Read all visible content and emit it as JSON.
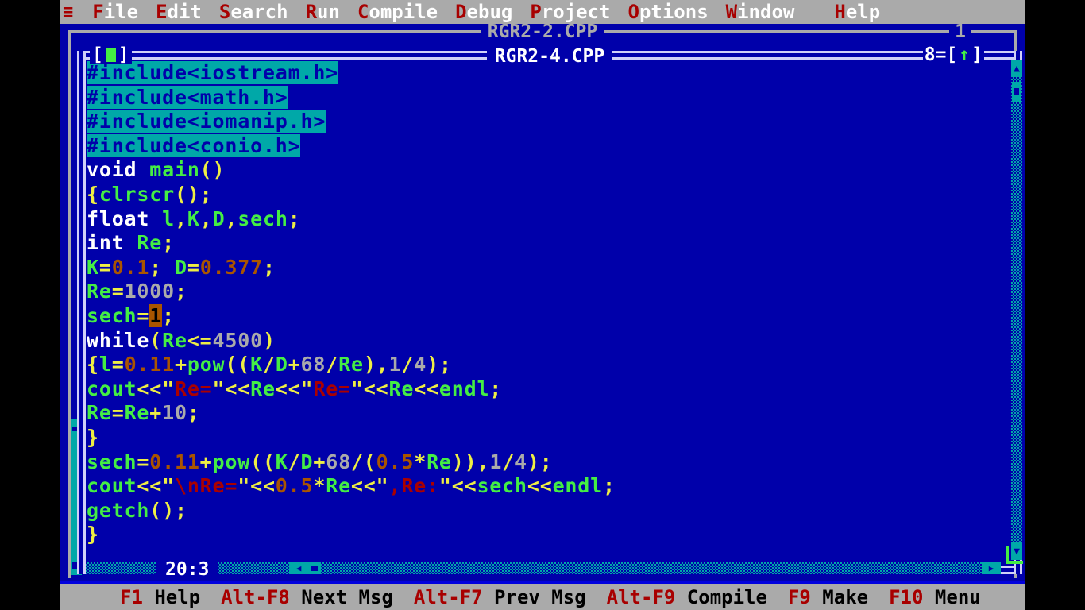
{
  "app": {
    "title": "Turbo C++ IDE",
    "hamburger_icon": "hamburger-icon"
  },
  "menubar": {
    "items": [
      {
        "hot": "F",
        "rest": "ile"
      },
      {
        "hot": "E",
        "rest": "dit"
      },
      {
        "hot": "S",
        "rest": "earch"
      },
      {
        "hot": "R",
        "rest": "un"
      },
      {
        "hot": "C",
        "rest": "ompile"
      },
      {
        "hot": "D",
        "rest": "ebug"
      },
      {
        "hot": "P",
        "rest": "roject"
      },
      {
        "hot": "O",
        "rest": "ptions"
      },
      {
        "hot": "W",
        "rest": "indow"
      },
      {
        "hot": "H",
        "rest": "elp"
      }
    ]
  },
  "background_window": {
    "title": "RGR2-2.CPP",
    "number": "1"
  },
  "active_window": {
    "title": "RGR2-4.CPP",
    "number": "8",
    "close_left": "[",
    "close_right": "]",
    "zoom_left": "[",
    "zoom_right": "]",
    "zoom_arrow": "↑",
    "equals": "=",
    "cursor_position": "20:3"
  },
  "scrollbars": {
    "v_up_arrow": "▲",
    "v_down_arrow": "▼",
    "h_left_arrow": "◀",
    "h_right_arrow": "▶"
  },
  "editor": {
    "lines": [
      [
        {
          "t": "#include<iostream.h>",
          "c": "tk-pre"
        }
      ],
      [
        {
          "t": "#include<math.h>",
          "c": "tk-pre"
        }
      ],
      [
        {
          "t": "#include<iomanip.h>",
          "c": "tk-pre"
        }
      ],
      [
        {
          "t": "#include<conio.h>",
          "c": "tk-pre"
        }
      ],
      [
        {
          "t": "void",
          "c": "tk-kw"
        },
        {
          "t": " ",
          "c": "tk-id"
        },
        {
          "t": "main",
          "c": "tk-id"
        },
        {
          "t": "()",
          "c": "tk-punc"
        }
      ],
      [
        {
          "t": "{",
          "c": "tk-punc"
        },
        {
          "t": "clrscr",
          "c": "tk-id"
        },
        {
          "t": "();",
          "c": "tk-punc"
        }
      ],
      [
        {
          "t": "float",
          "c": "tk-kw"
        },
        {
          "t": " ",
          "c": "tk-id"
        },
        {
          "t": "l",
          "c": "tk-id"
        },
        {
          "t": ",",
          "c": "tk-punc"
        },
        {
          "t": "K",
          "c": "tk-id"
        },
        {
          "t": ",",
          "c": "tk-punc"
        },
        {
          "t": "D",
          "c": "tk-id"
        },
        {
          "t": ",",
          "c": "tk-punc"
        },
        {
          "t": "sech",
          "c": "tk-id"
        },
        {
          "t": ";",
          "c": "tk-punc"
        }
      ],
      [
        {
          "t": "int",
          "c": "tk-kw"
        },
        {
          "t": " ",
          "c": "tk-id"
        },
        {
          "t": "Re",
          "c": "tk-id"
        },
        {
          "t": ";",
          "c": "tk-punc"
        }
      ],
      [
        {
          "t": "K",
          "c": "tk-id"
        },
        {
          "t": "=",
          "c": "tk-punc"
        },
        {
          "t": "0.1",
          "c": "tk-num"
        },
        {
          "t": ";",
          "c": "tk-punc"
        },
        {
          "t": " ",
          "c": "tk-id"
        },
        {
          "t": "D",
          "c": "tk-id"
        },
        {
          "t": "=",
          "c": "tk-punc"
        },
        {
          "t": "0.377",
          "c": "tk-num"
        },
        {
          "t": ";",
          "c": "tk-punc"
        }
      ],
      [
        {
          "t": "Re",
          "c": "tk-id"
        },
        {
          "t": "=",
          "c": "tk-punc"
        },
        {
          "t": "1000",
          "c": "tk-int"
        },
        {
          "t": ";",
          "c": "tk-punc"
        }
      ],
      [
        {
          "t": "sech",
          "c": "tk-id"
        },
        {
          "t": "=",
          "c": "tk-punc"
        },
        {
          "t": "1",
          "c": "tk-cursor"
        },
        {
          "t": ";",
          "c": "tk-punc"
        }
      ],
      [
        {
          "t": "while",
          "c": "tk-kw"
        },
        {
          "t": "(",
          "c": "tk-punc"
        },
        {
          "t": "Re",
          "c": "tk-id"
        },
        {
          "t": "<=",
          "c": "tk-punc"
        },
        {
          "t": "4500",
          "c": "tk-int"
        },
        {
          "t": ")",
          "c": "tk-punc"
        }
      ],
      [
        {
          "t": "{",
          "c": "tk-punc"
        },
        {
          "t": "l",
          "c": "tk-id"
        },
        {
          "t": "=",
          "c": "tk-punc"
        },
        {
          "t": "0.11",
          "c": "tk-num"
        },
        {
          "t": "+",
          "c": "tk-punc"
        },
        {
          "t": "pow",
          "c": "tk-id"
        },
        {
          "t": "((",
          "c": "tk-punc"
        },
        {
          "t": "K",
          "c": "tk-id"
        },
        {
          "t": "/",
          "c": "tk-punc"
        },
        {
          "t": "D",
          "c": "tk-id"
        },
        {
          "t": "+",
          "c": "tk-punc"
        },
        {
          "t": "68",
          "c": "tk-int"
        },
        {
          "t": "/",
          "c": "tk-punc"
        },
        {
          "t": "Re",
          "c": "tk-id"
        },
        {
          "t": "),",
          "c": "tk-punc"
        },
        {
          "t": "1",
          "c": "tk-int"
        },
        {
          "t": "/",
          "c": "tk-punc"
        },
        {
          "t": "4",
          "c": "tk-int"
        },
        {
          "t": ");",
          "c": "tk-punc"
        }
      ],
      [
        {
          "t": "cout",
          "c": "tk-id"
        },
        {
          "t": "<<",
          "c": "tk-punc"
        },
        {
          "t": "\"",
          "c": "tk-quote"
        },
        {
          "t": "Re=",
          "c": "tk-str"
        },
        {
          "t": "\"",
          "c": "tk-quote"
        },
        {
          "t": "<<",
          "c": "tk-punc"
        },
        {
          "t": "Re",
          "c": "tk-id"
        },
        {
          "t": "<<",
          "c": "tk-punc"
        },
        {
          "t": "\"",
          "c": "tk-quote"
        },
        {
          "t": "Re=",
          "c": "tk-str"
        },
        {
          "t": "\"",
          "c": "tk-quote"
        },
        {
          "t": "<<",
          "c": "tk-punc"
        },
        {
          "t": "Re",
          "c": "tk-id"
        },
        {
          "t": "<<",
          "c": "tk-punc"
        },
        {
          "t": "endl",
          "c": "tk-id"
        },
        {
          "t": ";",
          "c": "tk-punc"
        }
      ],
      [
        {
          "t": "Re",
          "c": "tk-id"
        },
        {
          "t": "=",
          "c": "tk-punc"
        },
        {
          "t": "Re",
          "c": "tk-id"
        },
        {
          "t": "+",
          "c": "tk-punc"
        },
        {
          "t": "10",
          "c": "tk-int"
        },
        {
          "t": ";",
          "c": "tk-punc"
        }
      ],
      [
        {
          "t": "}",
          "c": "tk-punc"
        }
      ],
      [
        {
          "t": "sech",
          "c": "tk-id"
        },
        {
          "t": "=",
          "c": "tk-punc"
        },
        {
          "t": "0.11",
          "c": "tk-num"
        },
        {
          "t": "+",
          "c": "tk-punc"
        },
        {
          "t": "pow",
          "c": "tk-id"
        },
        {
          "t": "((",
          "c": "tk-punc"
        },
        {
          "t": "K",
          "c": "tk-id"
        },
        {
          "t": "/",
          "c": "tk-punc"
        },
        {
          "t": "D",
          "c": "tk-id"
        },
        {
          "t": "+",
          "c": "tk-punc"
        },
        {
          "t": "68",
          "c": "tk-int"
        },
        {
          "t": "/(",
          "c": "tk-punc"
        },
        {
          "t": "0.5",
          "c": "tk-num"
        },
        {
          "t": "*",
          "c": "tk-punc"
        },
        {
          "t": "Re",
          "c": "tk-id"
        },
        {
          "t": ")),",
          "c": "tk-punc"
        },
        {
          "t": "1",
          "c": "tk-int"
        },
        {
          "t": "/",
          "c": "tk-punc"
        },
        {
          "t": "4",
          "c": "tk-int"
        },
        {
          "t": ");",
          "c": "tk-punc"
        }
      ],
      [
        {
          "t": "cout",
          "c": "tk-id"
        },
        {
          "t": "<<",
          "c": "tk-punc"
        },
        {
          "t": "\"",
          "c": "tk-quote"
        },
        {
          "t": "\\nRe=",
          "c": "tk-str"
        },
        {
          "t": "\"",
          "c": "tk-quote"
        },
        {
          "t": "<<",
          "c": "tk-punc"
        },
        {
          "t": "0.5",
          "c": "tk-num"
        },
        {
          "t": "*",
          "c": "tk-punc"
        },
        {
          "t": "Re",
          "c": "tk-id"
        },
        {
          "t": "<<",
          "c": "tk-punc"
        },
        {
          "t": "\"",
          "c": "tk-quote"
        },
        {
          "t": ",Re:",
          "c": "tk-str"
        },
        {
          "t": "\"",
          "c": "tk-quote"
        },
        {
          "t": "<<",
          "c": "tk-punc"
        },
        {
          "t": "sech",
          "c": "tk-id"
        },
        {
          "t": "<<",
          "c": "tk-punc"
        },
        {
          "t": "endl",
          "c": "tk-id"
        },
        {
          "t": ";",
          "c": "tk-punc"
        }
      ],
      [
        {
          "t": "getch",
          "c": "tk-id"
        },
        {
          "t": "();",
          "c": "tk-punc"
        }
      ],
      [
        {
          "t": "}",
          "c": "tk-punc"
        }
      ]
    ]
  },
  "statusbar": {
    "items": [
      {
        "key": "F1",
        "label": " Help"
      },
      {
        "key": "Alt-F8",
        "label": " Next Msg"
      },
      {
        "key": "Alt-F7",
        "label": " Prev Msg"
      },
      {
        "key": "Alt-F9",
        "label": " Compile"
      },
      {
        "key": "F9",
        "label": " Make"
      },
      {
        "key": "F10",
        "label": " Menu"
      }
    ]
  },
  "colors": {
    "menubar_bg": "#aaaaaa",
    "desktop_bg": "#0000aa",
    "hotkey_red": "#a80000",
    "editor_bg": "#0000aa",
    "preproc_hilite": "#00a8a8",
    "identifier_green": "#44ee44",
    "punctuation_yellow": "#eeee44",
    "float_brown": "#aa5500",
    "int_gray": "#aaaaaa",
    "string_red": "#aa0000",
    "cursor_bg": "#aa5500",
    "active_border": "#d0d0f8",
    "inactive_border": "#aaaaaa"
  }
}
